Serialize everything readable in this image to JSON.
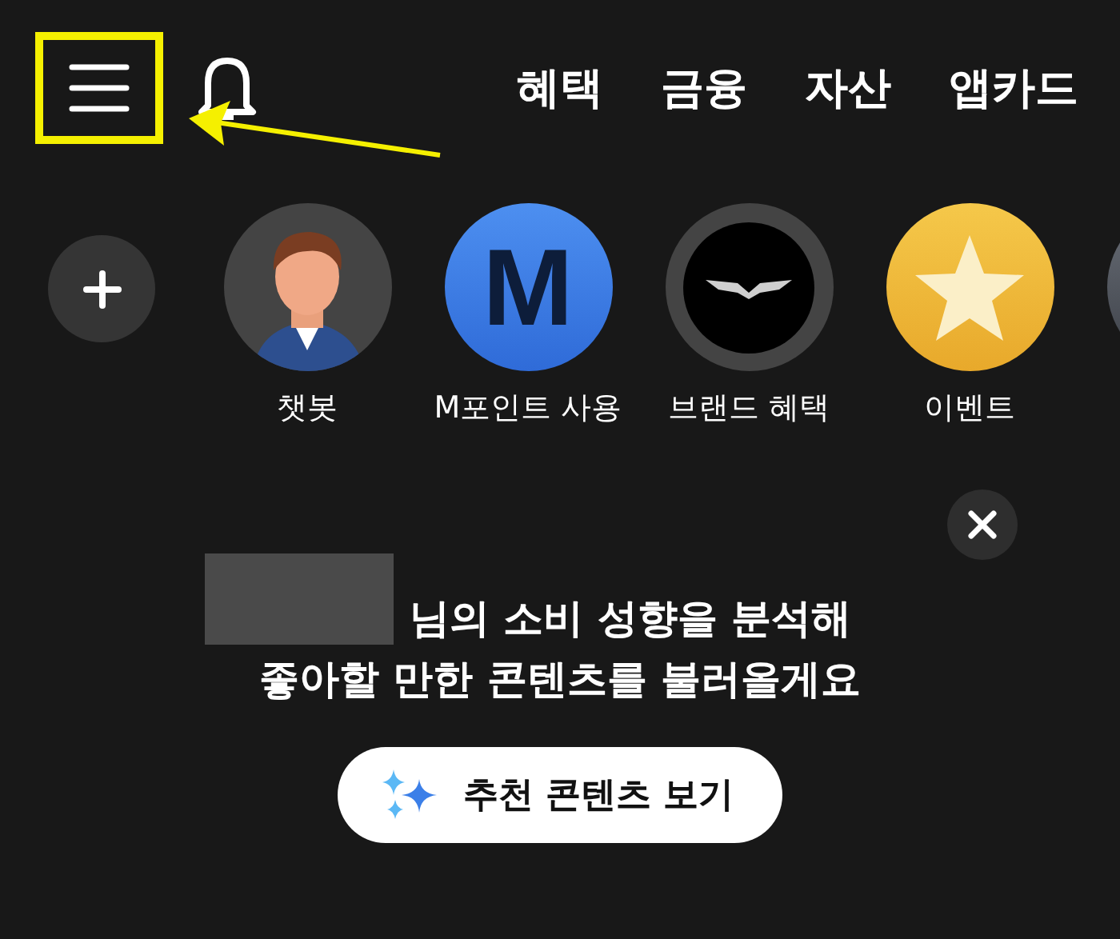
{
  "header": {
    "nav_tabs": [
      {
        "label": "혜택"
      },
      {
        "label": "금융"
      },
      {
        "label": "자산"
      },
      {
        "label": "앱카드"
      }
    ]
  },
  "shortcuts": [
    {
      "kind": "avatar",
      "label": "챗봇"
    },
    {
      "kind": "letter",
      "letter": "M",
      "label": "M포인트 사용"
    },
    {
      "kind": "emblem",
      "label": "브랜드 혜택"
    },
    {
      "kind": "star",
      "label": "이벤트"
    },
    {
      "kind": "partial"
    }
  ],
  "recommendation": {
    "name_redacted": true,
    "line_1": "님의 소비 성향을 분석해",
    "line_2": "좋아할 만한 콘텐츠를 불러올게요",
    "button": "추천 콘텐츠 보기"
  },
  "annotation": {
    "highlight": true,
    "arrow": true
  }
}
